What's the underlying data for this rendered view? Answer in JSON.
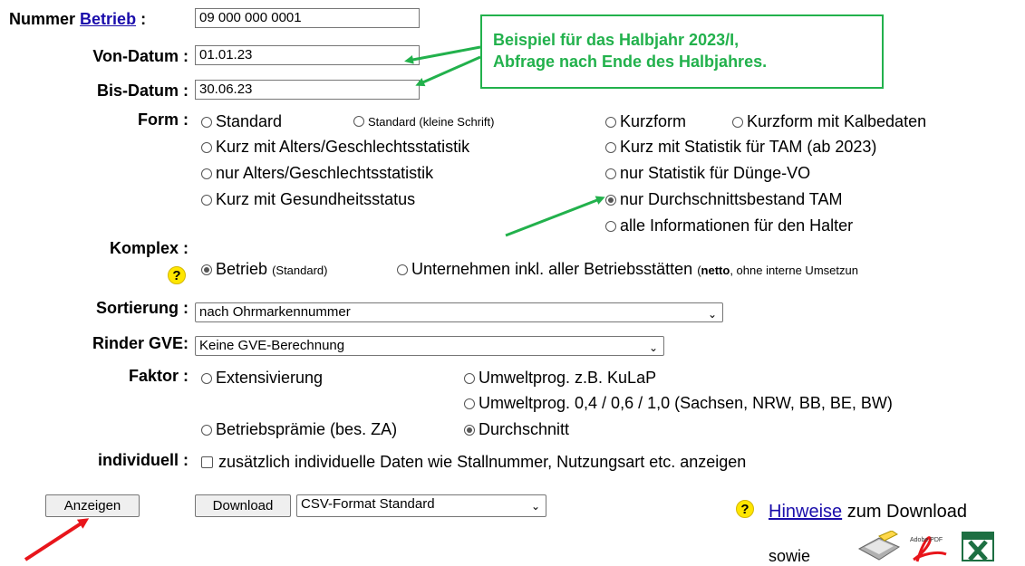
{
  "labels": {
    "nummer": "Nummer",
    "betrieb_link": "Betrieb",
    "colon": ":",
    "von_datum": "Von-Datum :",
    "bis_datum": "Bis-Datum :",
    "form": "Form :",
    "komplex": "Komplex :",
    "sortierung": "Sortierung :",
    "rinder_gve": "Rinder GVE:",
    "faktor": "Faktor :",
    "individuell": "individuell :"
  },
  "fields": {
    "nummer_value": "09 000 000 0001",
    "von_value": "01.01.23",
    "bis_value": "30.06.23"
  },
  "callout": {
    "line1": "Beispiel für das Halbjahr 2023/I,",
    "line2": "Abfrage nach Ende des Halbjahres."
  },
  "form_options": {
    "standard": "Standard",
    "standard_small": "Standard (kleine Schrift)",
    "kurzform": "Kurzform",
    "kurzform_kalbe": "Kurzform mit Kalbedaten",
    "kurz_alters": "Kurz mit Alters/Geschlechtsstatistik",
    "kurz_tam": "Kurz mit Statistik für TAM (ab 2023)",
    "nur_alters": "nur Alters/Geschlechtsstatistik",
    "nur_duenge": "nur Statistik für Dünge-VO",
    "kurz_gesund": "Kurz mit Gesundheitsstatus",
    "nur_durchschnitt": "nur Durchschnittsbestand TAM",
    "alle_info": "alle Informationen für den Halter",
    "selected": "nur Durchschnittsbestand TAM"
  },
  "komplex": {
    "betrieb": "Betrieb",
    "betrieb_hint": "(Standard)",
    "unternehmen": "Unternehmen inkl. aller Betriebsstätten",
    "hint_open": "(",
    "hint_bold": "netto",
    "hint_rest": ", ohne interne Umsetzun",
    "selected": "Betrieb"
  },
  "sortierung": {
    "value": "nach Ohrmarkennummer"
  },
  "rinder_gve": {
    "value": "Keine GVE-Berechnung"
  },
  "faktor": {
    "extensivierung": "Extensivierung",
    "umwelt_kulap": "Umweltprog. z.B. KuLaP",
    "umwelt_sachsen": "Umweltprog. 0,4 / 0,6 / 1,0 (Sachsen, NRW, BB, BE, BW)",
    "betriebspraemie": "Betriebsprämie (bes. ZA)",
    "durchschnitt": "Durchschnitt",
    "selected": "Durchschnitt"
  },
  "individuell": {
    "label": "zusätzlich individuelle Daten wie Stallnummer, Nutzungsart etc. anzeigen",
    "checked": false
  },
  "buttons": {
    "anzeigen": "Anzeigen",
    "download": "Download",
    "format": "CSV-Format Standard"
  },
  "hinweise": {
    "link": "Hinweise",
    "rest": "zum Download",
    "sowie": "sowie"
  },
  "help_glyph": "?",
  "dropdown_glyph": "⌄",
  "colors": {
    "arrow_green": "#22b14c",
    "arrow_red": "#e8151b",
    "link": "#1a0dab",
    "help_yellow": "#ffe600"
  }
}
